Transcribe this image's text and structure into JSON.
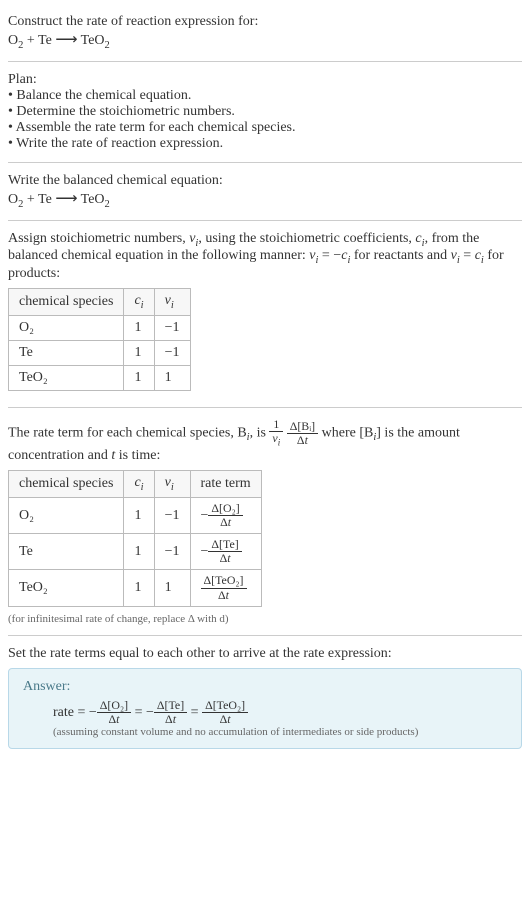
{
  "header": {
    "title": "Construct the rate of reaction expression for:",
    "equation_lhs1": "O",
    "equation_lhs1_sub": "2",
    "equation_plus": " + Te ",
    "equation_arrow": "⟶",
    "equation_rhs": " TeO",
    "equation_rhs_sub": "2"
  },
  "plan": {
    "title": "Plan:",
    "items": [
      "• Balance the chemical equation.",
      "• Determine the stoichiometric numbers.",
      "• Assemble the rate term for each chemical species.",
      "• Write the rate of reaction expression."
    ]
  },
  "balanced": {
    "title": "Write the balanced chemical equation:"
  },
  "stoich": {
    "intro1": "Assign stoichiometric numbers, ",
    "nu": "ν",
    "sub_i": "i",
    "intro2": ", using the stoichiometric coefficients, ",
    "c": "c",
    "intro3": ", from the balanced chemical equation in the following manner: ",
    "eq1a": " = −",
    "intro4": " for reactants and ",
    "eq2a": " = ",
    "intro5": " for products:",
    "headers": [
      "chemical species",
      "cᵢ",
      "νᵢ"
    ],
    "rows": [
      {
        "species": "O₂",
        "c": "1",
        "nu": "−1"
      },
      {
        "species": "Te",
        "c": "1",
        "nu": "−1"
      },
      {
        "species": "TeO₂",
        "c": "1",
        "nu": "1"
      }
    ]
  },
  "rateterm": {
    "intro1": "The rate term for each chemical species, B",
    "intro2": ", is ",
    "frac1_num": "1",
    "frac1_den_nu": "ν",
    "frac1_den_i": "i",
    "frac2_num": "Δ[Bᵢ]",
    "frac2_den": "Δt",
    "intro3": " where [B",
    "intro4": "] is the amount concentration and ",
    "t": "t",
    "intro5": " is time:",
    "headers": [
      "chemical species",
      "cᵢ",
      "νᵢ",
      "rate term"
    ],
    "rows": [
      {
        "species": "O₂",
        "c": "1",
        "nu": "−1",
        "rate_num": "Δ[O₂]",
        "rate_den": "Δt",
        "neg": "−"
      },
      {
        "species": "Te",
        "c": "1",
        "nu": "−1",
        "rate_num": "Δ[Te]",
        "rate_den": "Δt",
        "neg": "−"
      },
      {
        "species": "TeO₂",
        "c": "1",
        "nu": "1",
        "rate_num": "Δ[TeO₂]",
        "rate_den": "Δt",
        "neg": ""
      }
    ],
    "note": "(for infinitesimal rate of change, replace Δ with d)"
  },
  "final": {
    "title": "Set the rate terms equal to each other to arrive at the rate expression:",
    "answer_label": "Answer:",
    "rate_eq": "rate = −",
    "f1_num": "Δ[O₂]",
    "f1_den": "Δt",
    "eq": " = −",
    "f2_num": "Δ[Te]",
    "f2_den": "Δt",
    "eq2": " = ",
    "f3_num": "Δ[TeO₂]",
    "f3_den": "Δt",
    "note": "(assuming constant volume and no accumulation of intermediates or side products)"
  }
}
